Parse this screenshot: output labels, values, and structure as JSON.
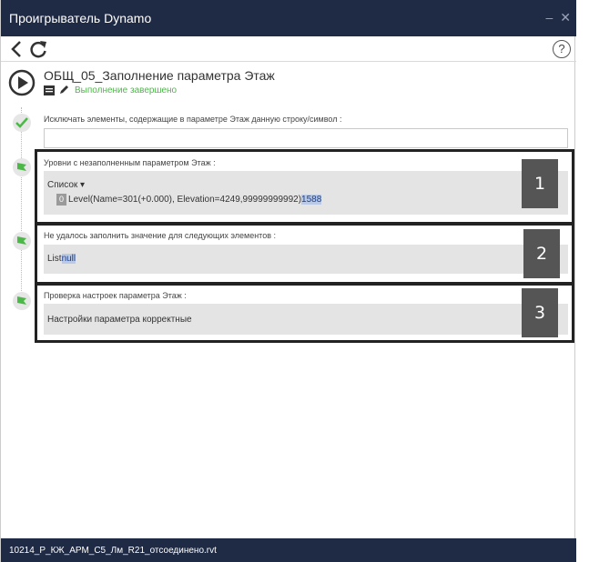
{
  "window": {
    "title": "Проигрыватель Dynamo",
    "minimize_symbol": "–",
    "close_symbol": "✕"
  },
  "toolbar": {
    "back_icon": "chevron-left-icon",
    "refresh_icon": "refresh-icon",
    "help_symbol": "?"
  },
  "script": {
    "name": "ОБЩ_05_Заполнение параметра Этаж",
    "status": "Выполнение завершено",
    "status_color": "#4cb848"
  },
  "inputs": [
    {
      "label": "Исключать элементы, содержащие в параметре Этаж данную строку/символ :",
      "value": ""
    }
  ],
  "outputs": [
    {
      "label": "Уровни с незаполненным параметром Этаж :",
      "list_header": "Список ▾",
      "items": [
        {
          "index": "0",
          "text": "Level(Name=301(+0.000), Elevation=4249,99999999992)",
          "id": "1588"
        }
      ],
      "badge": "1"
    },
    {
      "label": "Не удалось заполнить значение для следующих элементов :",
      "list_prefix": "List",
      "value": "null",
      "badge": "2"
    },
    {
      "label": "Проверка настроек параметра Этаж :",
      "value": "Настройки параметра корректные",
      "badge": "3"
    }
  ],
  "statusbar": {
    "file": "10214_Р_КЖ_АРМ_С5_Лм_R21_отсоединено.rvt"
  },
  "colors": {
    "titlebar": "#1f2a44",
    "accent_green": "#4cb848",
    "highlight": "#b9c9e6"
  }
}
